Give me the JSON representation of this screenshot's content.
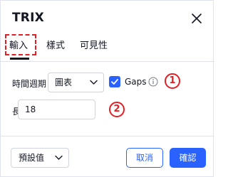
{
  "dialog": {
    "title": "TRIX",
    "close_icon": "close-icon"
  },
  "tabs": [
    {
      "label": "輸入",
      "active": true
    },
    {
      "label": "樣式",
      "active": false
    },
    {
      "label": "可見性",
      "active": false
    }
  ],
  "inputs": {
    "timeframe_label": "時間週期",
    "timeframe_value": "圖表",
    "gaps_label": "Gaps",
    "gaps_checked": true,
    "length_label": "長度",
    "length_value": "18"
  },
  "annotations": {
    "marker_1": "1",
    "marker_2": "2"
  },
  "footer": {
    "defaults_label": "預設值",
    "cancel_label": "取消",
    "ok_label": "確認"
  },
  "colors": {
    "accent": "#2962ff",
    "annotation": "#e31e24"
  }
}
